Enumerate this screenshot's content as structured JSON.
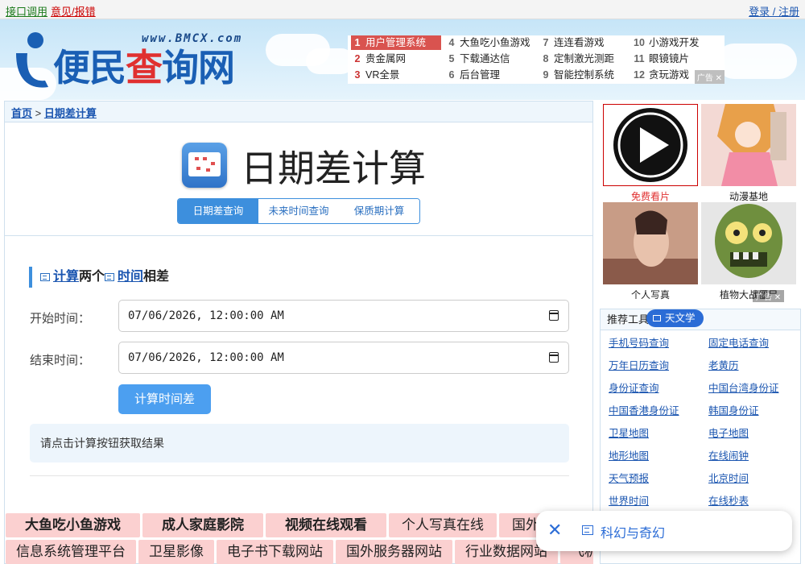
{
  "topbar": {
    "api_link": "接口调用",
    "report_link": "意见/报错",
    "login_link": "登录 / 注册"
  },
  "header": {
    "logo_url_text": "www.BMCX.com",
    "logo_text_blue": "便民",
    "logo_text_red": "查",
    "logo_text_blue2": "询网",
    "ad_items": [
      {
        "n": "1",
        "label": "用户管理系统"
      },
      {
        "n": "2",
        "label": "贵金属网"
      },
      {
        "n": "3",
        "label": "VR全景"
      },
      {
        "n": "4",
        "label": "大鱼吃小鱼游戏"
      },
      {
        "n": "5",
        "label": "下载通达信"
      },
      {
        "n": "6",
        "label": "后台管理"
      },
      {
        "n": "7",
        "label": "连连看游戏"
      },
      {
        "n": "8",
        "label": "定制激光测距"
      },
      {
        "n": "9",
        "label": "智能控制系统"
      },
      {
        "n": "10",
        "label": "小游戏开发"
      },
      {
        "n": "11",
        "label": "眼镜镜片"
      },
      {
        "n": "12",
        "label": "贪玩游戏"
      }
    ],
    "ad_tag": "广告 ✕"
  },
  "breadcrumb": {
    "home": "首页",
    "sep": ">",
    "current": "日期差计算"
  },
  "page": {
    "title": "日期差计算",
    "tabs": [
      "日期差查询",
      "未来时间查询",
      "保质期计算"
    ],
    "section_part1": "计算",
    "section_part2": "两个",
    "section_part3": "时间",
    "section_part4": "相差",
    "start_label": "开始时间：",
    "start_value": "07/06/2026, 12:00:00 AM",
    "end_label": "结束时间：",
    "end_value": "07/06/2026, 12:00:00 AM",
    "calc_button": "计算时间差",
    "result_text": "请点击计算按钮获取结果"
  },
  "tag_rows": [
    [
      {
        "t": "大鱼吃小鱼游戏",
        "b": true
      },
      {
        "t": "成人家庭影院",
        "b": true
      },
      {
        "t": "视频在线观看",
        "b": true
      },
      {
        "t": "个人写真在线",
        "b": false
      },
      {
        "t": "国外代理服务器",
        "b": false
      }
    ],
    [
      {
        "t": "信息系统管理平台",
        "b": false
      },
      {
        "t": "卫星影像",
        "b": false
      },
      {
        "t": "电子书下载网站",
        "b": false
      },
      {
        "t": "国外服务器网站",
        "b": false
      },
      {
        "t": "行业数据网站",
        "b": false
      },
      {
        "t": "飞机",
        "b": false
      }
    ]
  ],
  "right": {
    "pics": [
      "免费看片",
      "动漫基地",
      "个人写真",
      "植物大战僵尸"
    ],
    "ad_tag": "广告 ✕",
    "tools_title": "推荐工具",
    "pill_label": "天文学",
    "tools": [
      "手机号码查询",
      "固定电话查询",
      "万年日历查询",
      "老黄历",
      "身份证查询",
      "中国台湾身份证",
      "中国香港身份证",
      "韩国身份证",
      "卫星地图",
      "电子地图",
      "地形地图",
      "在线闹钟",
      "天气预报",
      "北京时间",
      "世界时间",
      "在线秒表"
    ]
  },
  "popup": {
    "close": "✕",
    "text": "科幻与奇幻"
  }
}
